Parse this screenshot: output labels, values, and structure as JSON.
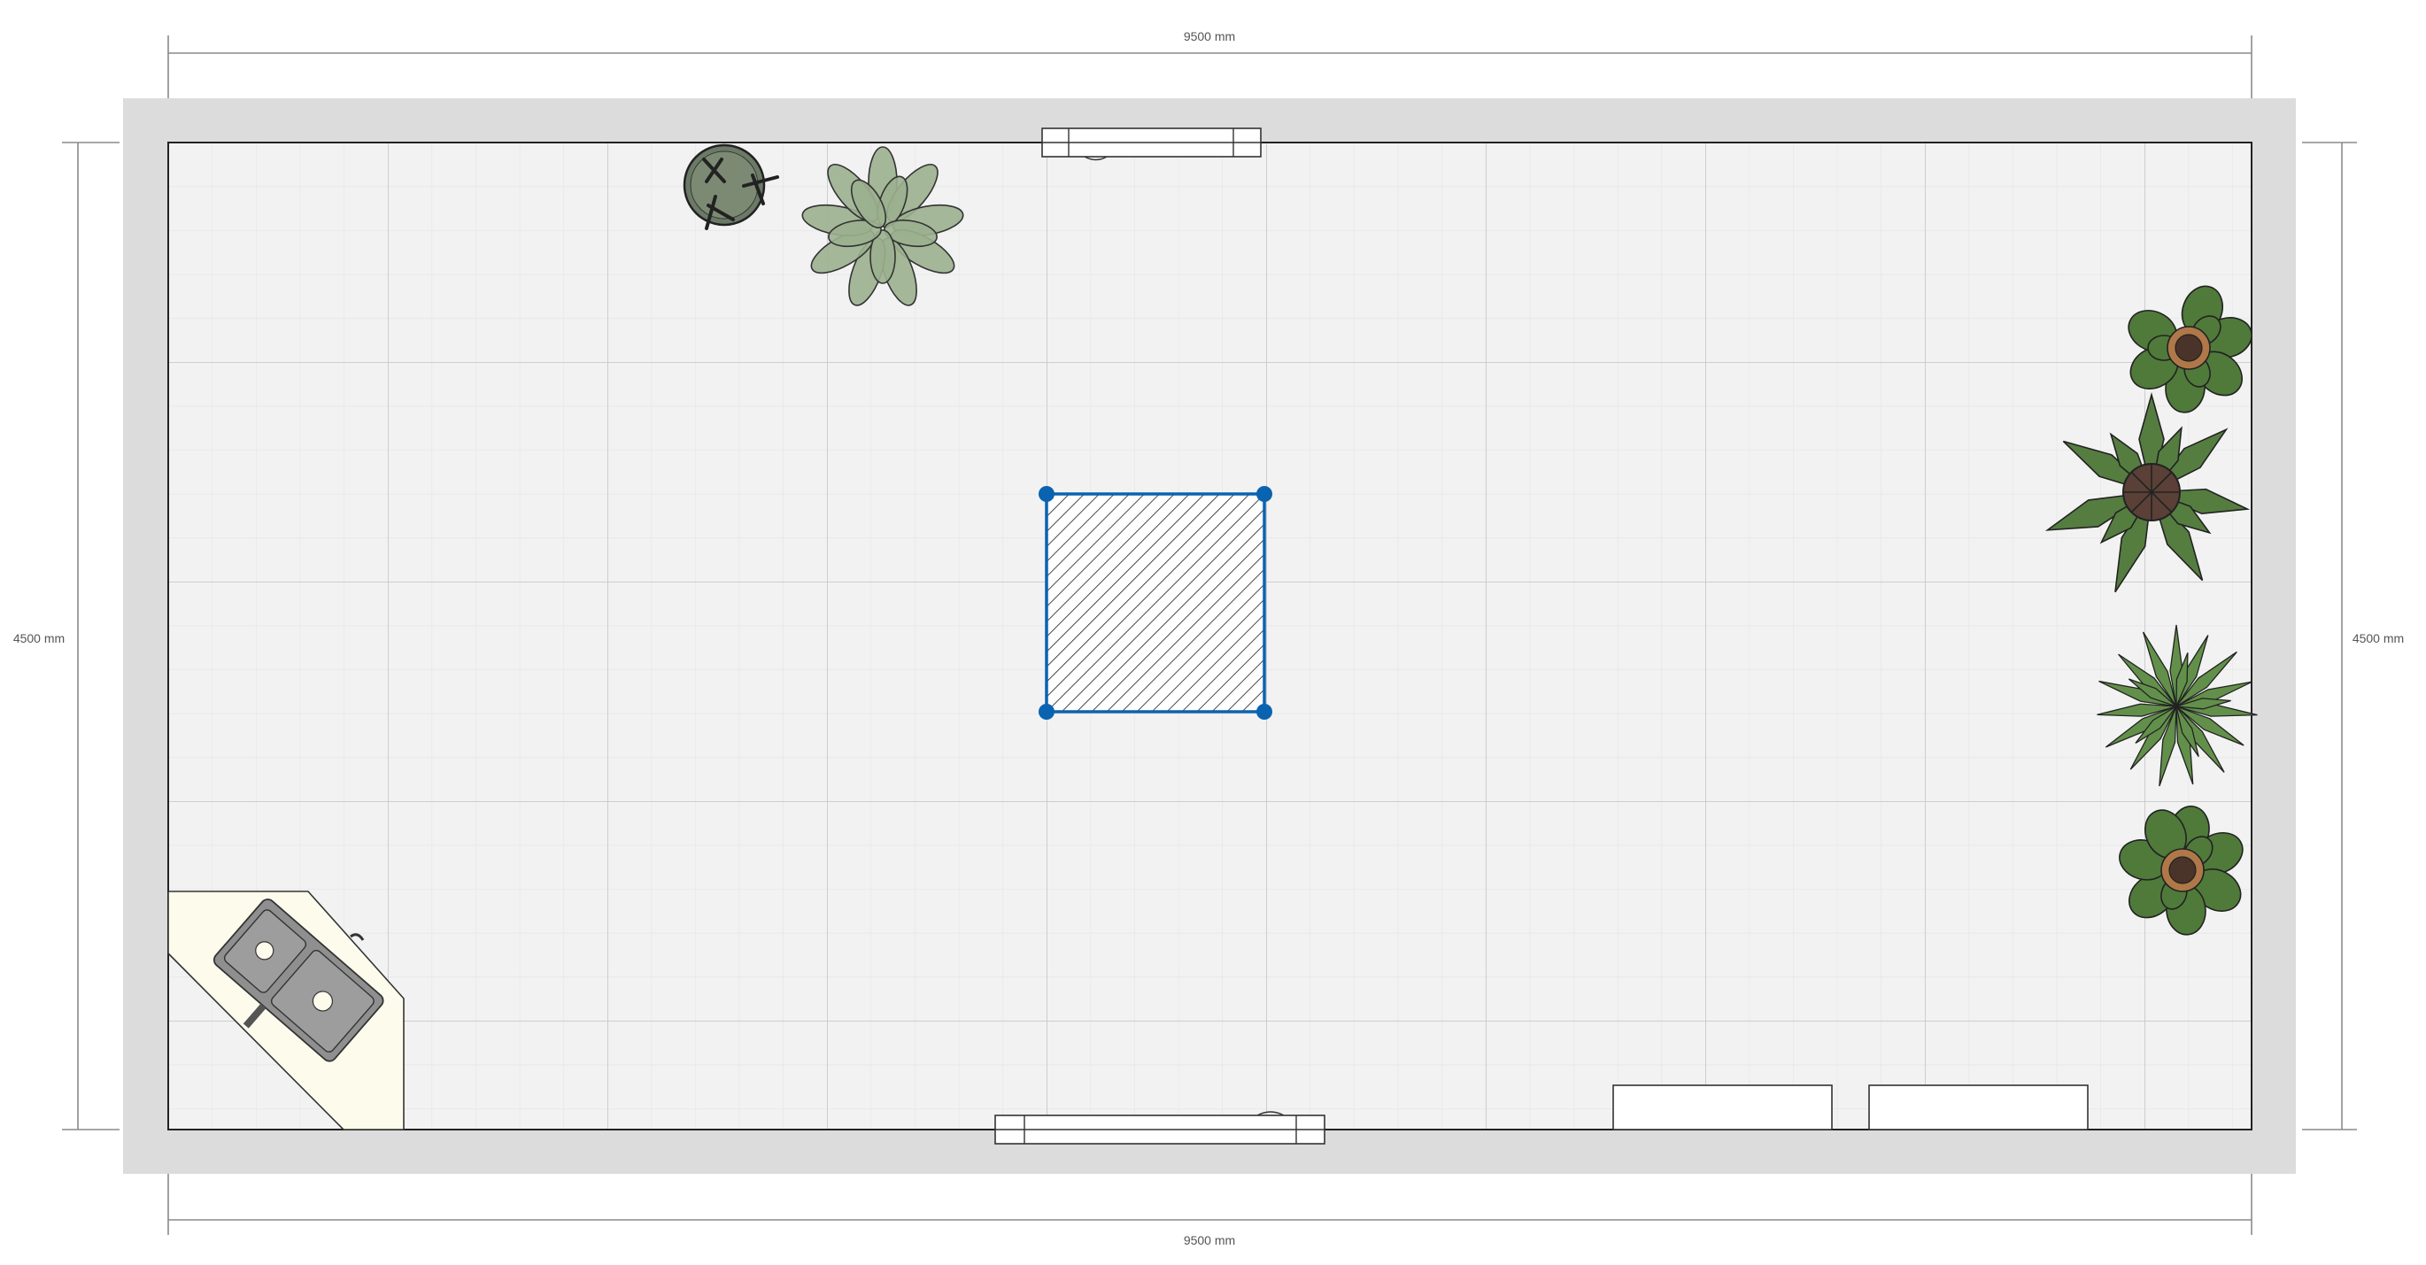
{
  "plan": {
    "dimensions": {
      "top": "9500 mm",
      "bottom": "9500 mm",
      "left": "4500 mm",
      "right": "4500 mm"
    },
    "colors": {
      "wall": "#dcdcdc",
      "floor": "#f2f2f2",
      "grid_major": "#c8c8c8",
      "grid_minor": "#e4e4e4",
      "selection": "#0a63b0",
      "counter": "#fdfcec",
      "sink": "#8a8a8a",
      "plant_dark": "#4f7a3a",
      "plant_light": "#8ea783",
      "pot_brown": "#5c4438"
    },
    "selected_object": "column",
    "items": [
      "window-top",
      "window-bottom",
      "corner-sink-counter",
      "cabinet-1",
      "cabinet-2",
      "cactus-pot",
      "succulent",
      "potted-plant-1",
      "potted-plant-2",
      "spiky-plant",
      "potted-plant-3"
    ]
  }
}
